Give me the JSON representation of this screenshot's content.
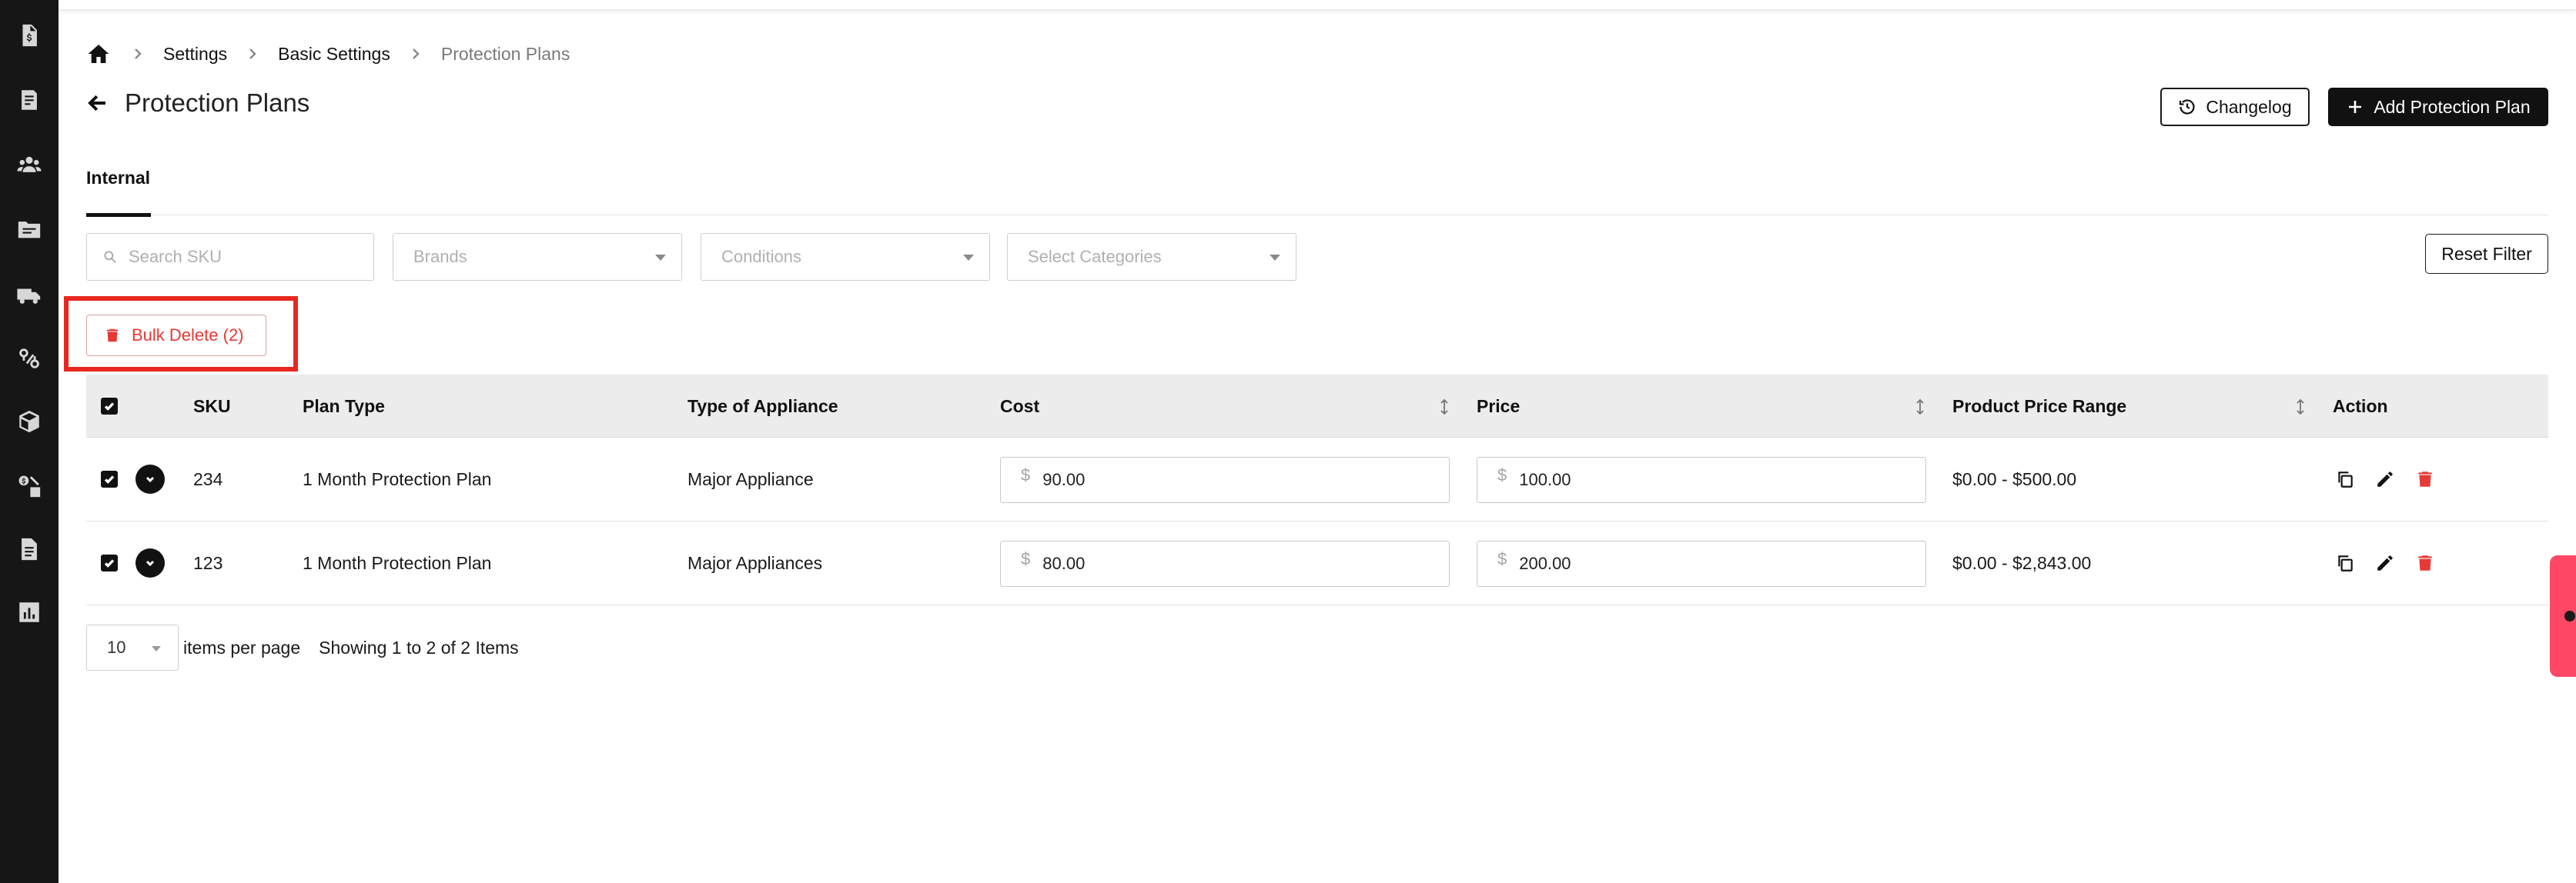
{
  "breadcrumb": {
    "items": [
      "Settings",
      "Basic Settings",
      "Protection Plans"
    ]
  },
  "page": {
    "title": "Protection Plans"
  },
  "header_buttons": {
    "changelog": "Changelog",
    "add": "Add Protection Plan"
  },
  "tabs": {
    "internal": "Internal"
  },
  "filters": {
    "search_placeholder": "Search SKU",
    "brands": "Brands",
    "conditions": "Conditions",
    "categories": "Select Categories",
    "reset": "Reset Filter"
  },
  "bulk": {
    "label": "Bulk Delete (2)"
  },
  "table": {
    "columns": {
      "sku": "SKU",
      "plan_type": "Plan Type",
      "appliance": "Type of Appliance",
      "cost": "Cost",
      "price": "Price",
      "range": "Product Price Range",
      "action": "Action"
    },
    "currency_symbol": "$",
    "rows": [
      {
        "sku": "234",
        "plan_type": "1 Month Protection Plan",
        "appliance": "Major Appliance",
        "cost": "90.00",
        "price": "100.00",
        "range": "$0.00 - $500.00"
      },
      {
        "sku": "123",
        "plan_type": "1 Month Protection Plan",
        "appliance": "Major Appliances",
        "cost": "80.00",
        "price": "200.00",
        "range": "$0.00 - $2,843.00"
      }
    ]
  },
  "pagination": {
    "per_page": "10",
    "per_page_label": "items per page",
    "showing": "Showing 1 to 2 of 2 Items"
  },
  "sidebar_icons": [
    "invoice-icon",
    "orders-icon",
    "customers-icon",
    "inventory-folder-icon",
    "delivery-truck-icon",
    "integrations-icon",
    "products-box-icon",
    "pricing-icon",
    "documents-icon",
    "reports-icon"
  ],
  "colors": {
    "sidebar": "#161616",
    "danger": "#e53935",
    "highlight": "#e8281f",
    "primary_dark": "#111111",
    "feedback": "#ff4766"
  }
}
